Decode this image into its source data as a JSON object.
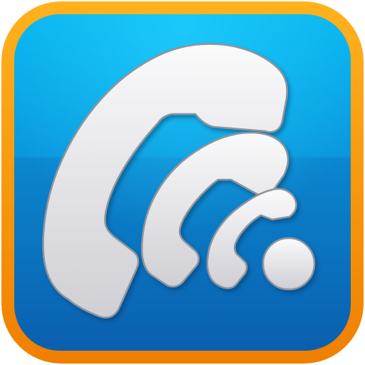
{
  "icon": {
    "name": "wifi-call-app-icon",
    "glyph": "handset-wave-icon"
  },
  "colors": {
    "frame_orange_light": "#FFB21E",
    "frame_orange_dark": "#F07F00",
    "tile_blue_top": "#07B4EE",
    "tile_blue_bottom": "#0A5FAE",
    "glyph_white": "#F4F4F6",
    "glyph_gray": "#CDCDD2",
    "glyph_outline": "#8E959C"
  }
}
